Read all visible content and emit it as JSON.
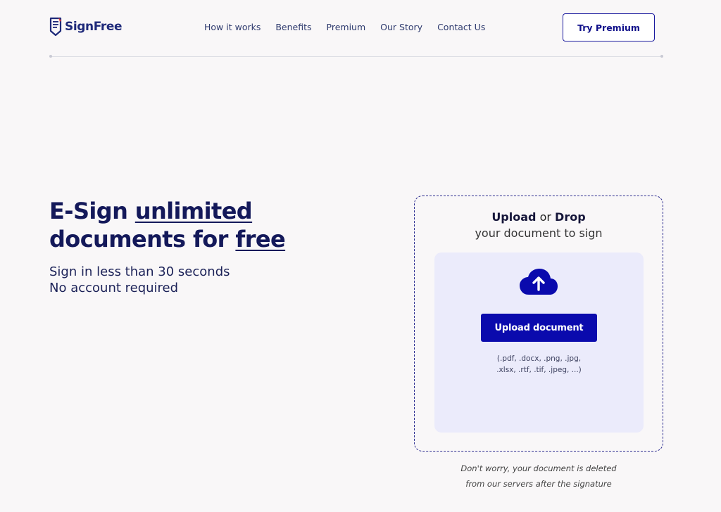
{
  "header": {
    "brand": "SignFree",
    "nav": [
      "How it works",
      "Benefits",
      "Premium",
      "Our Story",
      "Contact Us"
    ],
    "cta": "Try Premium"
  },
  "hero": {
    "title_part1": "E-Sign ",
    "title_link1": "unlimited",
    "title_part2": "documents for ",
    "title_link2": "free",
    "sub_line1": "Sign in less than 30 seconds",
    "sub_line2": "No account required"
  },
  "upload": {
    "head_upload": "Upload",
    "head_or": "or",
    "head_drop": "Drop",
    "head_line2": "your document to sign",
    "button": "Upload document",
    "formats_line1": "(.pdf, .docx, .png, .jpg,",
    "formats_line2": ".xlsx, .rtf, .tif, .jpeg, ...)",
    "icon": "cloud-upload-icon"
  },
  "note": {
    "line1": "Don't worry, your document is deleted",
    "line2": "from our servers after the signature"
  },
  "colors": {
    "brand": "#1f2a7a",
    "primary_button": "#0a0aad",
    "drop_zone": "#ebebfb",
    "text": "#14195a"
  }
}
